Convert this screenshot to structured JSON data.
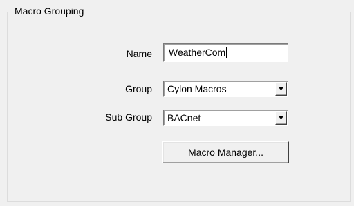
{
  "group": {
    "title": "Macro Grouping"
  },
  "fields": {
    "name": {
      "label": "Name",
      "value": "WeatherCom"
    },
    "group": {
      "label": "Group",
      "selected": "Cylon Macros"
    },
    "sub_group": {
      "label": "Sub Group",
      "selected": "BACnet"
    }
  },
  "buttons": {
    "macro_manager_label": "Macro Manager..."
  },
  "icons": {
    "dropdown": "chevron-down-icon"
  },
  "colors": {
    "background": "#f0f0f0",
    "field_background": "#ffffff",
    "frame_border": "#dcdcdc"
  }
}
